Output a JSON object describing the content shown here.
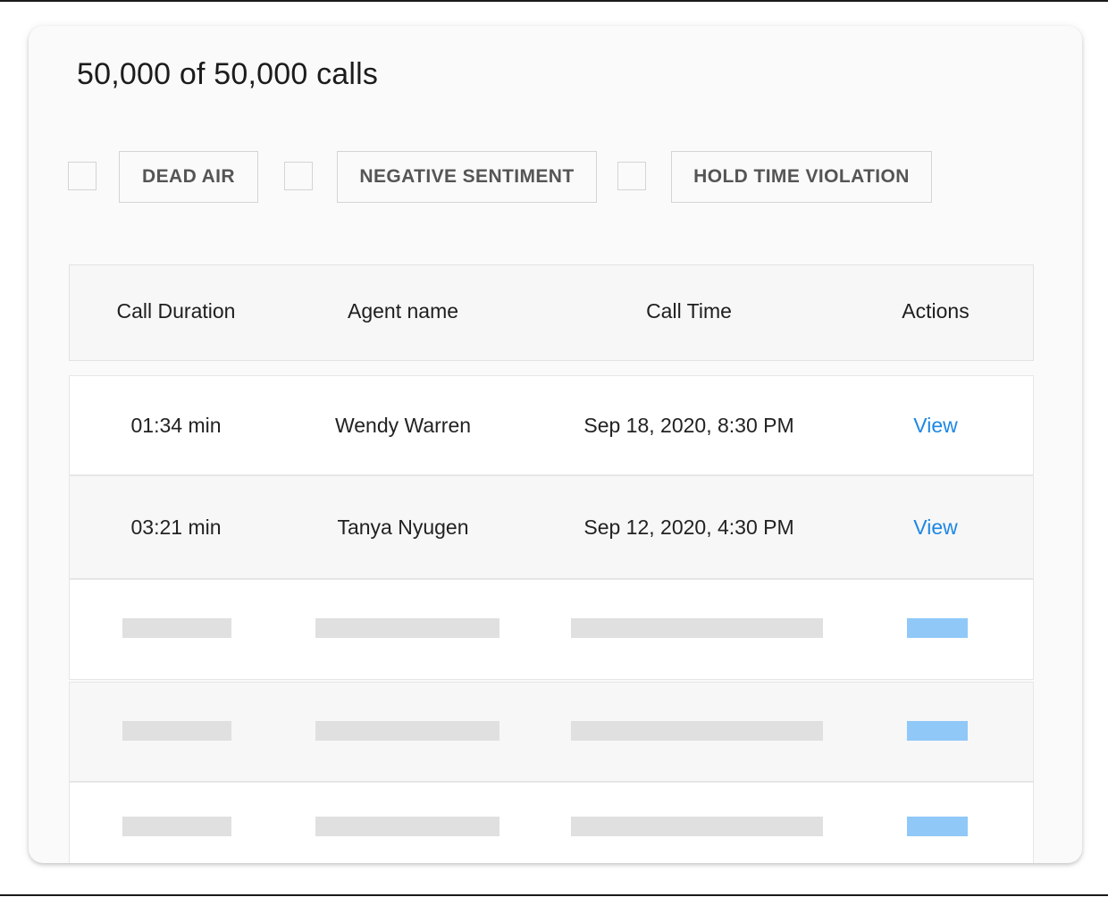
{
  "header": {
    "title": "50,000 of 50,000 calls"
  },
  "filters": [
    {
      "label": "DEAD AIR",
      "checked": false
    },
    {
      "label": "NEGATIVE SENTIMENT",
      "checked": false
    },
    {
      "label": "HOLD TIME VIOLATION",
      "checked": false
    }
  ],
  "table": {
    "columns": [
      "Call Duration",
      "Agent name",
      "Call Time",
      "Actions"
    ],
    "rows": [
      {
        "duration": "01:34 min",
        "agent": "Wendy Warren",
        "time": "Sep 18, 2020, 8:30 PM",
        "action": "View"
      },
      {
        "duration": "03:21 min",
        "agent": "Tanya Nyugen",
        "time": "Sep 12, 2020, 4:30 PM",
        "action": "View"
      }
    ],
    "loading_rows": 3
  },
  "colors": {
    "link": "#1d87e4",
    "skeleton": "#e0e0e0",
    "skeleton_accent": "#90c8f8"
  }
}
